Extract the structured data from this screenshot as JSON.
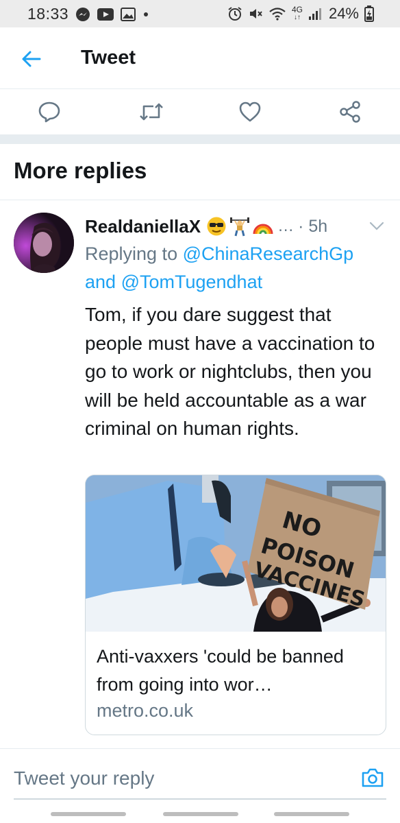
{
  "status_bar": {
    "time": "18:33",
    "network": "4G",
    "battery": "24%"
  },
  "header": {
    "title": "Tweet",
    "back_icon": "arrow-left-icon"
  },
  "actions": {
    "reply_icon": "reply-bubble-icon",
    "retweet_icon": "retweet-icon",
    "like_icon": "heart-icon",
    "share_icon": "share-icon"
  },
  "section": {
    "title": "More replies"
  },
  "tweet": {
    "author_name": "RealdaniellaX",
    "ellipsis": "…",
    "time": "· 5h",
    "replying_prefix": "Replying to ",
    "mention_1": "@ChinaResearchGp",
    "and_word": " and ",
    "mention_2": "@TomTugendhat",
    "text": "Tom, if you dare suggest that people must have a vaccination to go to work or nightclubs, then you will be held accountable as a war criminal on human rights.",
    "card": {
      "sign_text": "NO POISON VACCINES",
      "title": "Anti-vaxxers 'could be banned from going into wor…",
      "domain": "metro.co.uk"
    }
  },
  "reply_bar": {
    "placeholder": "Tweet your reply"
  },
  "colors": {
    "accent": "#1da1f2",
    "secondary_text": "#657786",
    "divider": "#e6ecf0"
  }
}
